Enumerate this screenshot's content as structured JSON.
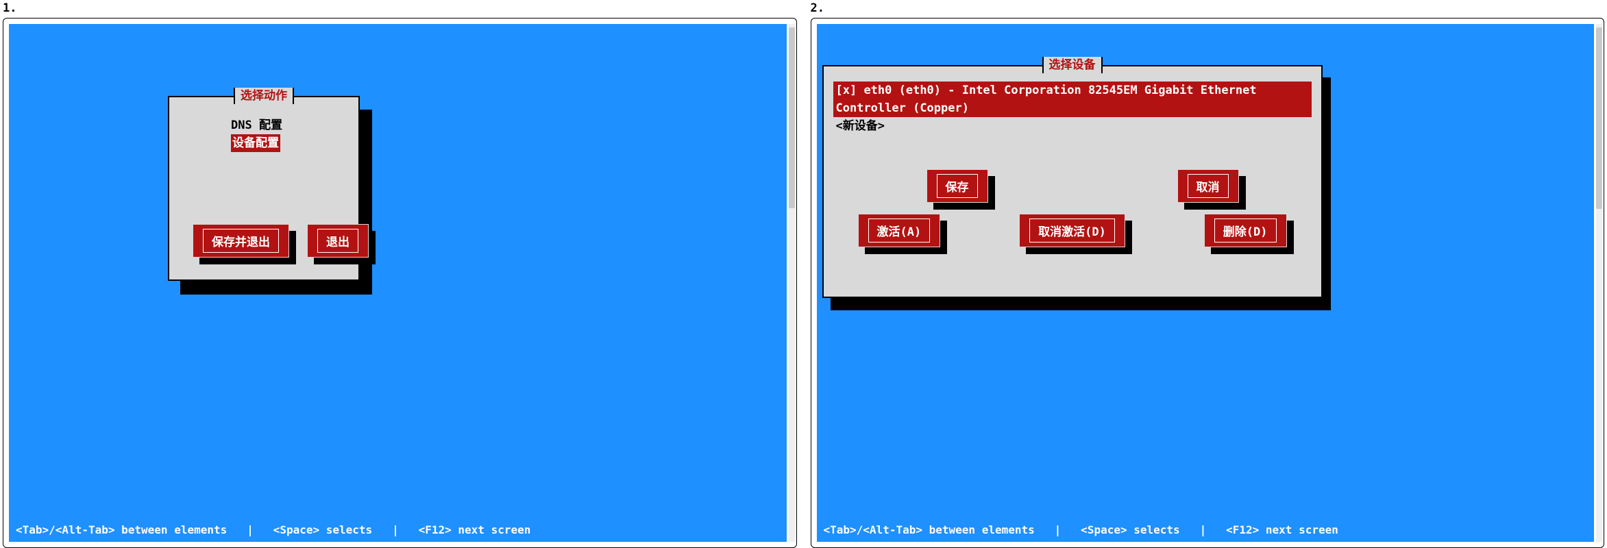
{
  "panels": [
    {
      "number": "1."
    },
    {
      "number": "2."
    }
  ],
  "panel1": {
    "dialog_title": "选择动作",
    "menu": {
      "dns": "DNS 配置",
      "device": "设备配置"
    },
    "buttons": {
      "save_exit": "保存并退出",
      "exit": "退出"
    }
  },
  "panel2": {
    "dialog_title": "选择设备",
    "devices": {
      "eth0": "[x] eth0 (eth0) - Intel Corporation 82545EM Gigabit Ethernet Controller (Copper)",
      "new": "<新设备>"
    },
    "buttons": {
      "save": "保存",
      "cancel": "取消",
      "activate": "激活(A)",
      "deactivate": "取消激活(D)",
      "delete": "删除(D)"
    }
  },
  "help_bar": "<Tab>/<Alt-Tab> between elements   |   <Space> selects   |   <F12> next screen"
}
